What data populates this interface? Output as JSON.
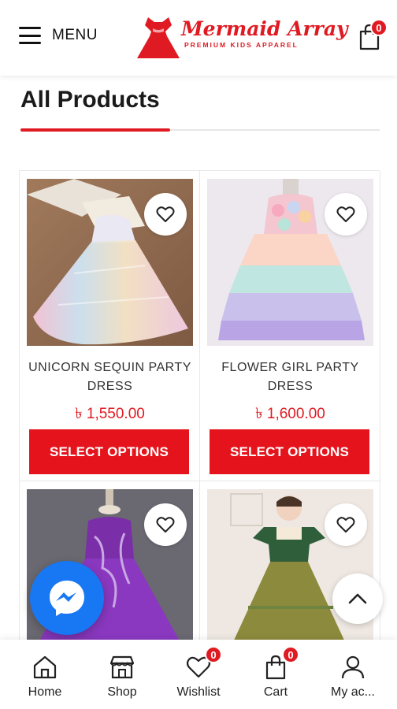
{
  "header": {
    "menu_label": "MENU",
    "logo_title": "Mermaid Array",
    "logo_subtitle": "PREMIUM KIDS APPAREL",
    "cart_count": "0"
  },
  "page_title": "All Products",
  "products": [
    {
      "name": "UNICORN SEQUIN PARTY DRESS",
      "price": "৳ 1,550.00",
      "button": "SELECT OPTIONS"
    },
    {
      "name": "FLOWER GIRL PARTY DRESS",
      "price": "৳ 1,600.00",
      "button": "SELECT OPTIONS"
    },
    {
      "name": "",
      "price": "",
      "button": ""
    },
    {
      "name": "",
      "price": "",
      "button": ""
    }
  ],
  "bottom_nav": {
    "home": "Home",
    "shop": "Shop",
    "wishlist": "Wishlist",
    "wishlist_count": "0",
    "cart": "Cart",
    "cart_count": "0",
    "account": "My ac..."
  },
  "colors": {
    "accent": "#e01a22",
    "messenger": "#1877f2"
  },
  "icons": [
    "hamburger-icon",
    "bag-icon",
    "heart-icon",
    "messenger-icon",
    "chevron-up-icon",
    "home-icon",
    "shop-icon",
    "user-icon"
  ]
}
